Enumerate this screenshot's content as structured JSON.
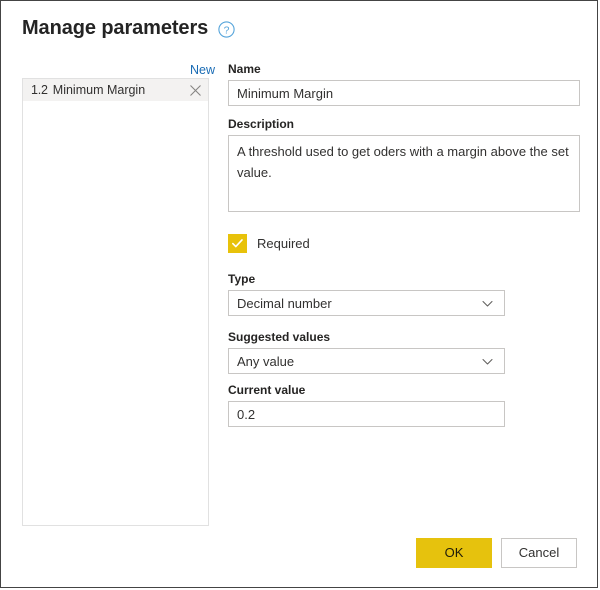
{
  "dialog": {
    "title": "Manage parameters",
    "help_icon": "help-circle-icon"
  },
  "list_panel": {
    "new_label": "New",
    "items": [
      {
        "type_badge": "1.2",
        "label": "Minimum Margin",
        "remove_icon": "close-icon"
      }
    ]
  },
  "form": {
    "name": {
      "label": "Name",
      "value": "Minimum Margin",
      "placeholder": ""
    },
    "description": {
      "label": "Description",
      "value": "A threshold used to get oders with a margin above the set value.",
      "placeholder": ""
    },
    "required": {
      "label": "Required",
      "checked": "true",
      "check_icon": "checkmark-icon"
    },
    "type": {
      "label": "Type",
      "value": "Decimal number",
      "chevron_icon": "chevron-down-icon",
      "options": [
        "Decimal number"
      ]
    },
    "suggested_values": {
      "label": "Suggested values",
      "value": "Any value",
      "chevron_icon": "chevron-down-icon",
      "options": [
        "Any value"
      ]
    },
    "current_value": {
      "label": "Current value",
      "value": "0.2",
      "placeholder": ""
    }
  },
  "footer": {
    "ok_label": "OK",
    "cancel_label": "Cancel"
  },
  "colors": {
    "accent_yellow": "#e6c20d",
    "link_blue": "#1a6cb5",
    "selected_row": "#f3f2f1",
    "border_gray": "#c8c6c4"
  }
}
